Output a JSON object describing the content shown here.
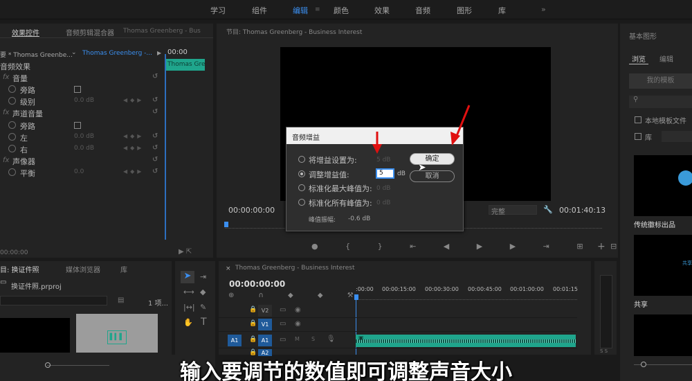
{
  "workspaces": [
    "学习",
    "组件",
    "编辑",
    "颜色",
    "效果",
    "音频",
    "图形",
    "库"
  ],
  "workspace_more": "»",
  "effect_controls": {
    "tab_effect": "效果控件",
    "tab_mixer": "音频剪辑混合器",
    "tab_mixer_seq": "Thomas Greenberg - Bus",
    "source": "要 * Thomas Greenbe...",
    "sequence": "Thomas Greenberg -...",
    "time": "00:00",
    "clip": "Thomas Gree",
    "audio_effects": "音频效果",
    "volume": "音量",
    "bypass": "旁路",
    "level": "级别",
    "level_val": "0.0 dB",
    "channel_volume": "声道音量",
    "left": "左",
    "left_val": "0.0 dB",
    "right": "右",
    "right_val": "0.0 dB",
    "panner": "声像器",
    "balance": "平衡",
    "balance_val": "0.0",
    "timecode": "00:00:00"
  },
  "program": {
    "tab": "节目: Thomas Greenberg - Business Interest",
    "timecode_left": "00:00:00:00",
    "timecode_right": "00:01:40:13",
    "quality": "完整"
  },
  "dialog": {
    "title": "音频增益",
    "opt1": "将增益设置为:",
    "opt1_val": "5 dB",
    "opt2": "调整增益值:",
    "opt2_input": "5",
    "opt2_unit": "dB",
    "opt3": "标准化最大峰值为:",
    "opt3_val": "0 dB",
    "opt4": "标准化所有峰值为:",
    "opt4_val": "0 dB",
    "peak_label": "峰值振幅:",
    "peak_val": "-0.6 dB",
    "ok": "确定",
    "cancel": "取消"
  },
  "project": {
    "tab_project": "目: 换证件照",
    "tab_media": "媒体浏览器",
    "tab_lib": "库",
    "file": "换证件照.prproj",
    "count": "1 项..."
  },
  "timeline": {
    "tab": "Thomas Greenberg - Business Interest",
    "timecode": "00:00:00:00",
    "ruler": [
      ":00:00",
      "00:00:15:00",
      "00:00:30:00",
      "00:00:45:00",
      "00:01:00:00",
      "00:01:15"
    ],
    "tracks": [
      "V2",
      "V1",
      "A1",
      "A2"
    ],
    "src_a1": "A1",
    "meter_label": "S S"
  },
  "essential_graphics": {
    "title": "基本图形",
    "tab_browse": "浏览",
    "tab_edit": "编辑",
    "my_templates": "我的模板",
    "local_templates": "本地模板文件",
    "library": "库",
    "tpl1": "传统徽标出品",
    "tpl2": "共享",
    "tpl2_inner": "共享"
  },
  "subtitle": "输入要调节的数值即可调整声音大小",
  "colors": {
    "accent": "#3b8ff0",
    "track_active": "#1f5a9a",
    "arrow": "#e01010",
    "clip": "#1fa58c"
  }
}
